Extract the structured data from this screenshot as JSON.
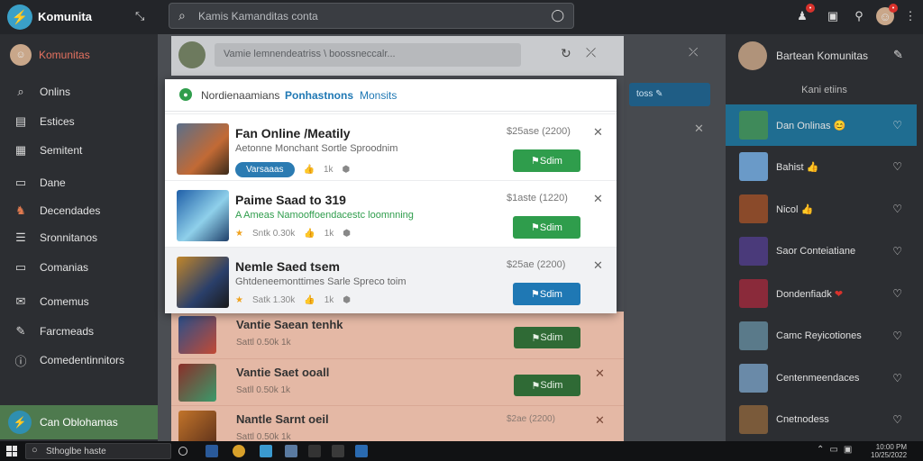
{
  "app": {
    "name": "Komunita",
    "sidebar_title": "Komunitas"
  },
  "search": {
    "placeholder": "Kamis Kamanditas conta"
  },
  "sidebar": {
    "items": [
      {
        "label": "Onlins",
        "icon": "search-icon"
      },
      {
        "label": "Estices",
        "icon": "bag-icon"
      },
      {
        "label": "Semitent",
        "icon": "inbox-icon"
      },
      {
        "label": "Dane",
        "icon": "list-icon"
      },
      {
        "label": "Decendades",
        "icon": "mascot-icon"
      },
      {
        "label": "Sronnitanos",
        "icon": "menu-icon"
      },
      {
        "label": "Comanias",
        "icon": "monitor-icon"
      },
      {
        "label": "Comemus",
        "icon": "chat-icon"
      },
      {
        "label": "Farcmeads",
        "icon": "pin-icon"
      },
      {
        "label": "Comedentinnitors",
        "icon": "info-icon"
      }
    ],
    "bottom_label": "Can Oblohamas"
  },
  "main": {
    "header_input": "Vamie lemnendeatriss \\ boossneccalr...",
    "ghost_button": "toss"
  },
  "popup": {
    "tabs": [
      "Nordienaamians",
      "Ponhastnons",
      "Monsits"
    ],
    "rows": [
      {
        "title": "Fan Online /Meatily",
        "subtitle": "Aetonne Monchant Sortle Sproodnim",
        "price": "$25ase (2200)",
        "pill": "Varsaaas",
        "likes": "1k",
        "button": "Sdim",
        "button_color": "#2f9d4c"
      },
      {
        "title": "Paime Saad to 319",
        "subtitle": "A Ameas Namooffoendacestc loomnning",
        "price": "$1aste (1220)",
        "rating": "Sntk 0.30k",
        "likes": "1k",
        "button": "Sdim",
        "button_color": "#2f9d4c"
      },
      {
        "title": "Nemle Saed tsem",
        "subtitle": "Ghtdeneemonttimes Sarle Spreco toim",
        "price": "$25ae (2200)",
        "rating": "Satk 1.30k",
        "likes": "1k",
        "button": "Sdim",
        "button_color": "#1f78b4"
      }
    ]
  },
  "background_rows": [
    {
      "title": "Vantie Saean tenhk",
      "meta": "Sattl 0.50k  1k",
      "button": "Sdim"
    },
    {
      "title": "Vantie Saet ooall",
      "meta": "Satll 0.50k  1k",
      "button": "Sdim"
    },
    {
      "title": "Nantle Sarnt oeil",
      "meta": "Sattl 0.50k  1k",
      "price": "$2ae (2200)"
    }
  ],
  "right_sidebar": {
    "header": "Bartean Komunitas",
    "sub": "Kani etiins",
    "items": [
      {
        "label": "Dan Onlinas",
        "emoji": "😊"
      },
      {
        "label": "Bahist",
        "emoji": "👍"
      },
      {
        "label": "Nicol",
        "emoji": "👍"
      },
      {
        "label": "Saor Conteiatiane",
        "emoji": ""
      },
      {
        "label": "Dondenfiadk",
        "emoji": "❤"
      },
      {
        "label": "Camc Reyicotiones",
        "emoji": ""
      },
      {
        "label": "Centenmeendaces",
        "emoji": ""
      },
      {
        "label": "Cnetnodess",
        "emoji": ""
      }
    ]
  },
  "taskbar": {
    "search": "Sthoglbe haste",
    "clock_time": "10:00 PM",
    "clock_date": "10/25/2022"
  },
  "colors": {
    "accent_blue": "#2b7bb2",
    "accent_green": "#2f9d4c",
    "active_row": "#1f6d91"
  }
}
